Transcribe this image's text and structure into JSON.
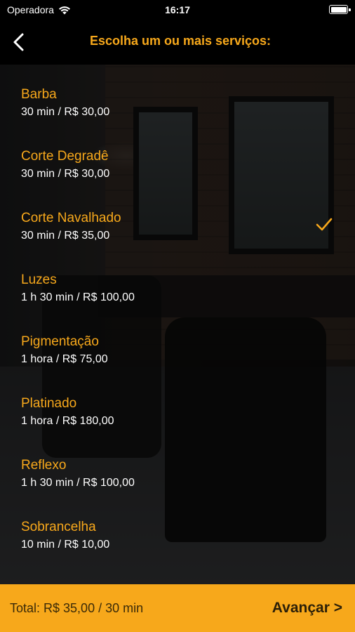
{
  "status_bar": {
    "carrier": "Operadora",
    "time": "16:17",
    "wifi_icon": "wifi-icon",
    "battery_icon": "battery-icon",
    "battery_level": 1.0
  },
  "nav": {
    "back_icon": "chevron-left-icon",
    "title": "Escolha um ou mais serviços:"
  },
  "services": [
    {
      "name": "Barba",
      "detail": "30 min / R$ 30,00",
      "selected": false
    },
    {
      "name": "Corte Degradê",
      "detail": "30 min / R$ 30,00",
      "selected": false
    },
    {
      "name": "Corte Navalhado",
      "detail": "30 min / R$ 35,00",
      "selected": true
    },
    {
      "name": "Luzes",
      "detail": "1 h 30 min / R$ 100,00",
      "selected": false
    },
    {
      "name": "Pigmentação",
      "detail": "1 hora / R$ 75,00",
      "selected": false
    },
    {
      "name": "Platinado",
      "detail": "1 hora / R$ 180,00",
      "selected": false
    },
    {
      "name": "Reflexo",
      "detail": "1 h 30 min / R$ 100,00",
      "selected": false
    },
    {
      "name": "Sobrancelha",
      "detail": "10 min / R$ 10,00",
      "selected": false
    }
  ],
  "footer": {
    "total": "Total: R$ 35,00 / 30 min",
    "next_label": "Avançar >"
  },
  "colors": {
    "accent": "#f7a81b",
    "background": "#000000",
    "footer_text": "#2b1f08"
  }
}
